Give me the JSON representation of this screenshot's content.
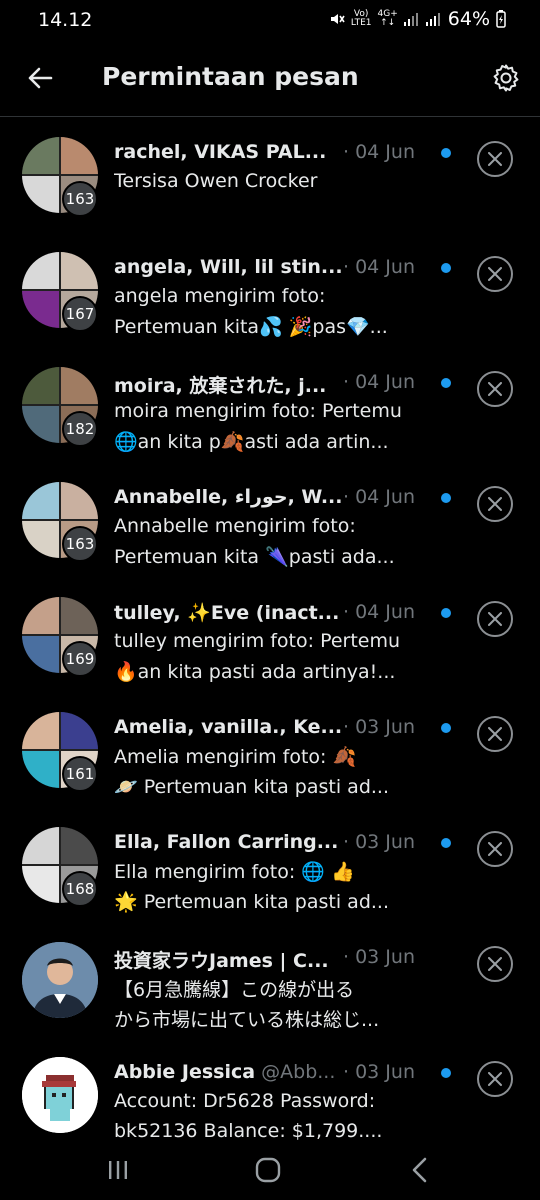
{
  "status": {
    "time": "14.12",
    "volte": "Vo)",
    "lte": "LTE1",
    "net": "4G+",
    "battery": "64%"
  },
  "header": {
    "title": "Permintaan pesan"
  },
  "colors": {
    "accent": "#1d9bf0",
    "muted": "#71767b",
    "text": "#e7e9ea",
    "divider": "#2f3336"
  },
  "requests": [
    {
      "name": "rachel, VIKAS  PAL...",
      "handle": "",
      "date": "· 04 Jun",
      "count": "163",
      "unread": true,
      "line1": "Tersisa Owen Crocker",
      "line2": "",
      "avatar": [
        "#6a7a60",
        "#b98a6e",
        "#d8d8d8",
        "#9a8c80"
      ]
    },
    {
      "name": "angela, Will, lil stin...",
      "handle": "",
      "date": "· 04 Jun",
      "count": "167",
      "unread": true,
      "line1": "angela mengirim foto:",
      "line2": "Pertemuan kita💦 🎉pas💎...",
      "avatar": [
        "#d9d9d9",
        "#cfc0b2",
        "#7a2b8f",
        "#b5a89c"
      ]
    },
    {
      "name": "moira, 放棄された, j...",
      "handle": "",
      "date": "· 04 Jun",
      "count": "182",
      "unread": true,
      "line1": "moira mengirim foto: Pertemu",
      "line2": "🌐an kita p🍂asti ada artin...",
      "avatar": [
        "#4d5a3c",
        "#a07c62",
        "#506a7a",
        "#8b6d57"
      ]
    },
    {
      "name": "Annabelle, حوراء, W...",
      "handle": "",
      "date": "· 04 Jun",
      "count": "163",
      "unread": true,
      "line1": "Annabelle mengirim foto:",
      "line2": "Pertemuan kita 🌂pasti ada...",
      "avatar": [
        "#9ac6d8",
        "#c9b0a0",
        "#d9d2c6",
        "#b89b86"
      ]
    },
    {
      "name": "tulley, ✨Eve (inact...",
      "handle": "",
      "date": "· 04 Jun",
      "count": "169",
      "unread": true,
      "line1": "tulley mengirim foto: Pertemu",
      "line2": "🔥an kita pasti ada artinya!...",
      "avatar": [
        "#c4a08a",
        "#6d6258",
        "#4a6fa0",
        "#c9b8a8"
      ]
    },
    {
      "name": "Amelia, vanilla., Ke...",
      "handle": "",
      "date": "· 03 Jun",
      "count": "161",
      "unread": true,
      "line1": "Amelia mengirim foto: 🍂",
      "line2": "🪐 Pertemuan kita pasti ad...",
      "avatar": [
        "#d8b49a",
        "#3b3f8f",
        "#2fb0c8",
        "#e0d4c8"
      ]
    },
    {
      "name": "Ella, Fallon Carring...",
      "handle": "",
      "date": "· 03 Jun",
      "count": "168",
      "unread": true,
      "line1": "Ella mengirim foto: 🌐 👍",
      "line2": "🌟 Pertemuan kita pasti ad...",
      "avatar": [
        "#d6d6d6",
        "#4b4b4b",
        "#e8e8e8",
        "#9a9a9a"
      ]
    },
    {
      "name": "投資家ラウJames | C...",
      "handle": "",
      "date": "· 03 Jun",
      "count": "",
      "unread": false,
      "line1": "【6月急騰線】この線が出る",
      "line2": "から市場に出ている株は総じ...",
      "avatar": [
        "#5f7e9e",
        "#5f7e9e",
        "#5f7e9e",
        "#5f7e9e"
      ]
    },
    {
      "name": "Abbie Jessica",
      "handle": " @Abb...",
      "date": "· 03 Jun",
      "count": "",
      "unread": true,
      "line1": "Account: Dr5628 Password:",
      "line2": "bk52136  Balance: $1,799....",
      "avatar": [
        "#ffffff",
        "#ffffff",
        "#ffffff",
        "#ffffff"
      ]
    }
  ],
  "icons": {
    "back": "arrow-left-icon",
    "settings": "gear-icon",
    "dismiss": "close-icon",
    "nav_recent": "recent-apps-icon",
    "nav_home": "home-icon",
    "nav_back": "nav-back-icon"
  }
}
